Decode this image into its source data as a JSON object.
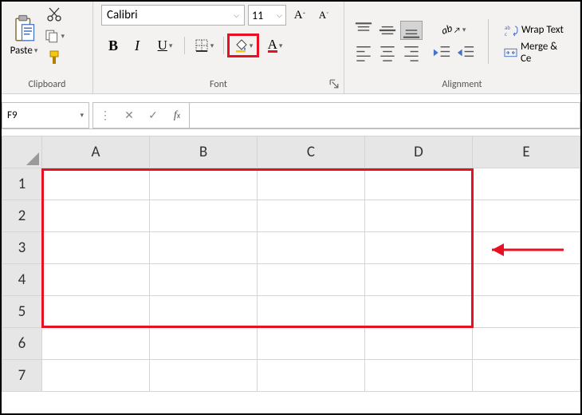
{
  "clipboard": {
    "paste": "Paste",
    "label": "Clipboard"
  },
  "font": {
    "name": "Calibri",
    "size": "11",
    "label": "Font",
    "bold": "B",
    "italic": "I",
    "underline": "U",
    "fillcolor_accent": "#f2c811",
    "fontcolor_accent": "#e81123"
  },
  "alignment": {
    "label": "Alignment",
    "wrap": "Wrap Text",
    "merge": "Merge & Ce"
  },
  "namebox": {
    "ref": "F9"
  },
  "columns": [
    "A",
    "B",
    "C",
    "D",
    "E"
  ],
  "rows": [
    "1",
    "2",
    "3",
    "4",
    "5",
    "6",
    "7"
  ]
}
